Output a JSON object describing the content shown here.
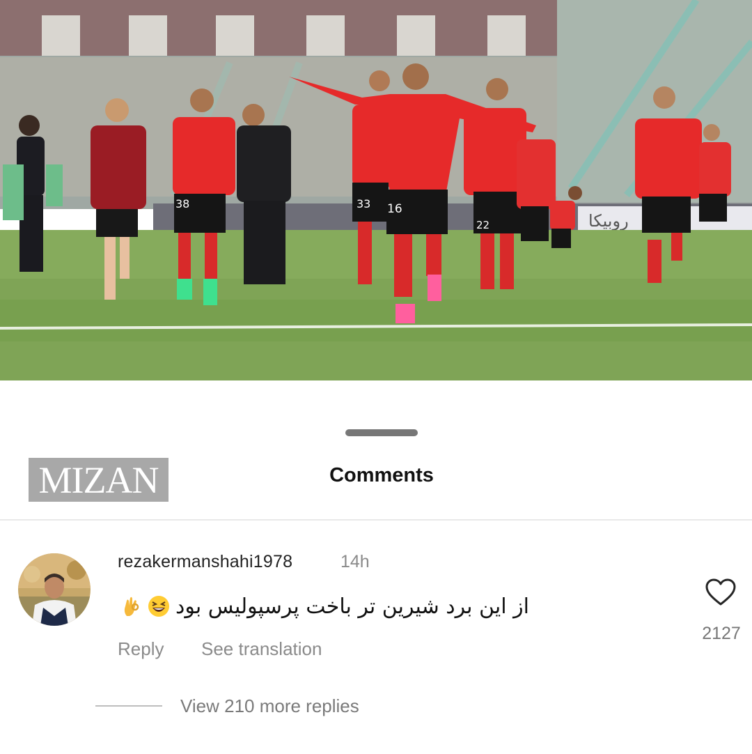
{
  "post": {
    "image_alt": "Football players in red kits celebrating on the pitch",
    "board_text": "روبیکا",
    "jersey_numbers": [
      "38",
      "33",
      "16",
      "22"
    ]
  },
  "sheet": {
    "title": "Comments",
    "watermark": "MIZAN"
  },
  "comment": {
    "username": "rezakermanshahi1978",
    "time": "14h",
    "text": "از این برد شیرین تر باخت پرسپولیس بود",
    "emojis": [
      "grinning-squinting-face",
      "ok-hand"
    ],
    "reply_label": "Reply",
    "translate_label": "See translation",
    "likes": "2127",
    "view_replies_label": "View 210 more replies"
  },
  "colors": {
    "kit_red": "#e62a2a",
    "pitch_green": "#7fa456",
    "secondary_text": "#8a8a8a"
  }
}
